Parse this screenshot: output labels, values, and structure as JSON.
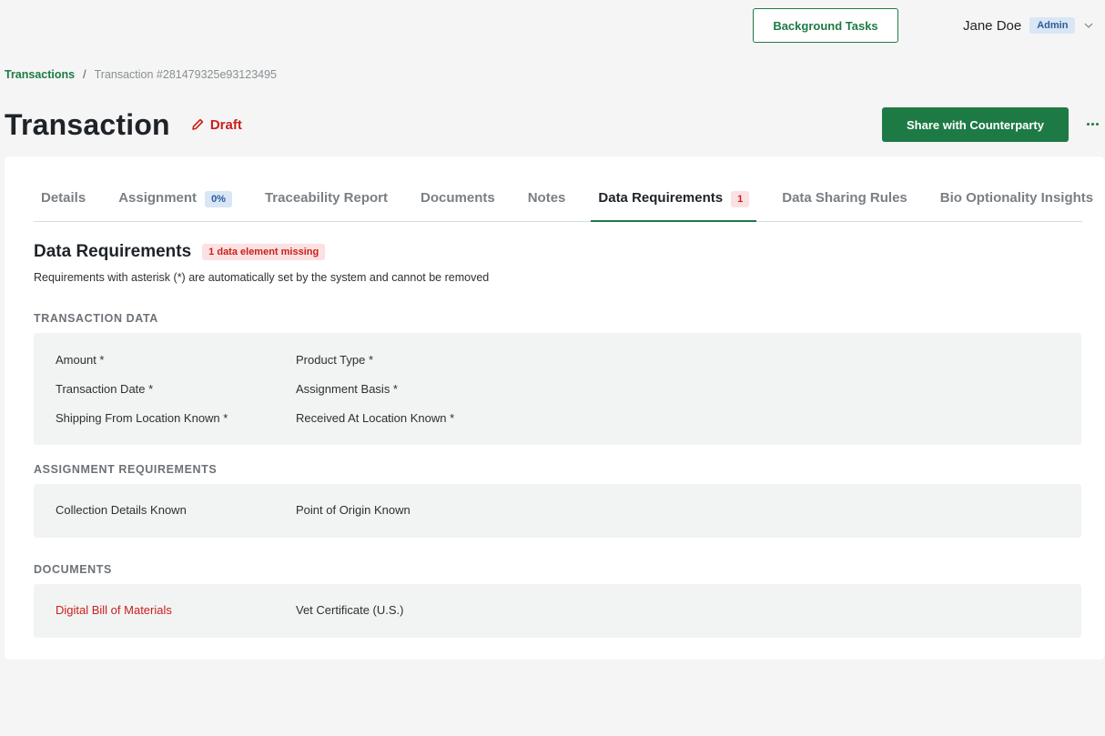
{
  "header": {
    "background_tasks_label": "Background Tasks",
    "user_name": "Jane Doe",
    "user_role": "Admin"
  },
  "breadcrumb": {
    "root": "Transactions",
    "separator": "/",
    "current": "Transaction #281479325e93123495"
  },
  "page": {
    "title": "Transaction",
    "status": "Draft",
    "share_label": "Share with Counterparty"
  },
  "tabs": [
    {
      "label": "Details",
      "badge": null
    },
    {
      "label": "Assignment",
      "badge": "0%"
    },
    {
      "label": "Traceability Report",
      "badge": null
    },
    {
      "label": "Documents",
      "badge": null
    },
    {
      "label": "Notes",
      "badge": null
    },
    {
      "label": "Data Requirements",
      "badge": "1"
    },
    {
      "label": "Data Sharing Rules",
      "badge": null
    },
    {
      "label": "Bio Optionality Insights",
      "badge": null
    }
  ],
  "section": {
    "title": "Data Requirements",
    "missing_badge": "1 data element missing",
    "description": "Requirements with asterisk (*) are automatically set by the system and cannot be removed"
  },
  "groups": {
    "transaction_data": {
      "label": "TRANSACTION DATA",
      "items": [
        "Amount *",
        "Product Type *",
        "Transaction Date *",
        "Assignment Basis *",
        "Shipping From Location Known *",
        "Received At Location Known *"
      ]
    },
    "assignment_requirements": {
      "label": "ASSIGNMENT REQUIREMENTS",
      "items": [
        "Collection Details Known",
        "Point of Origin Known"
      ]
    },
    "documents": {
      "label": "DOCUMENTS",
      "items": [
        "Digital Bill of Materials",
        "Vet Certificate (U.S.)"
      ]
    }
  },
  "colors": {
    "brand": "#1e7a45",
    "danger": "#c8211d",
    "info_badge_bg": "#d9e6f5"
  },
  "icons": {
    "draft": "pencil-icon",
    "user_menu": "chevron-down-icon",
    "more": "more-horizontal-icon"
  }
}
